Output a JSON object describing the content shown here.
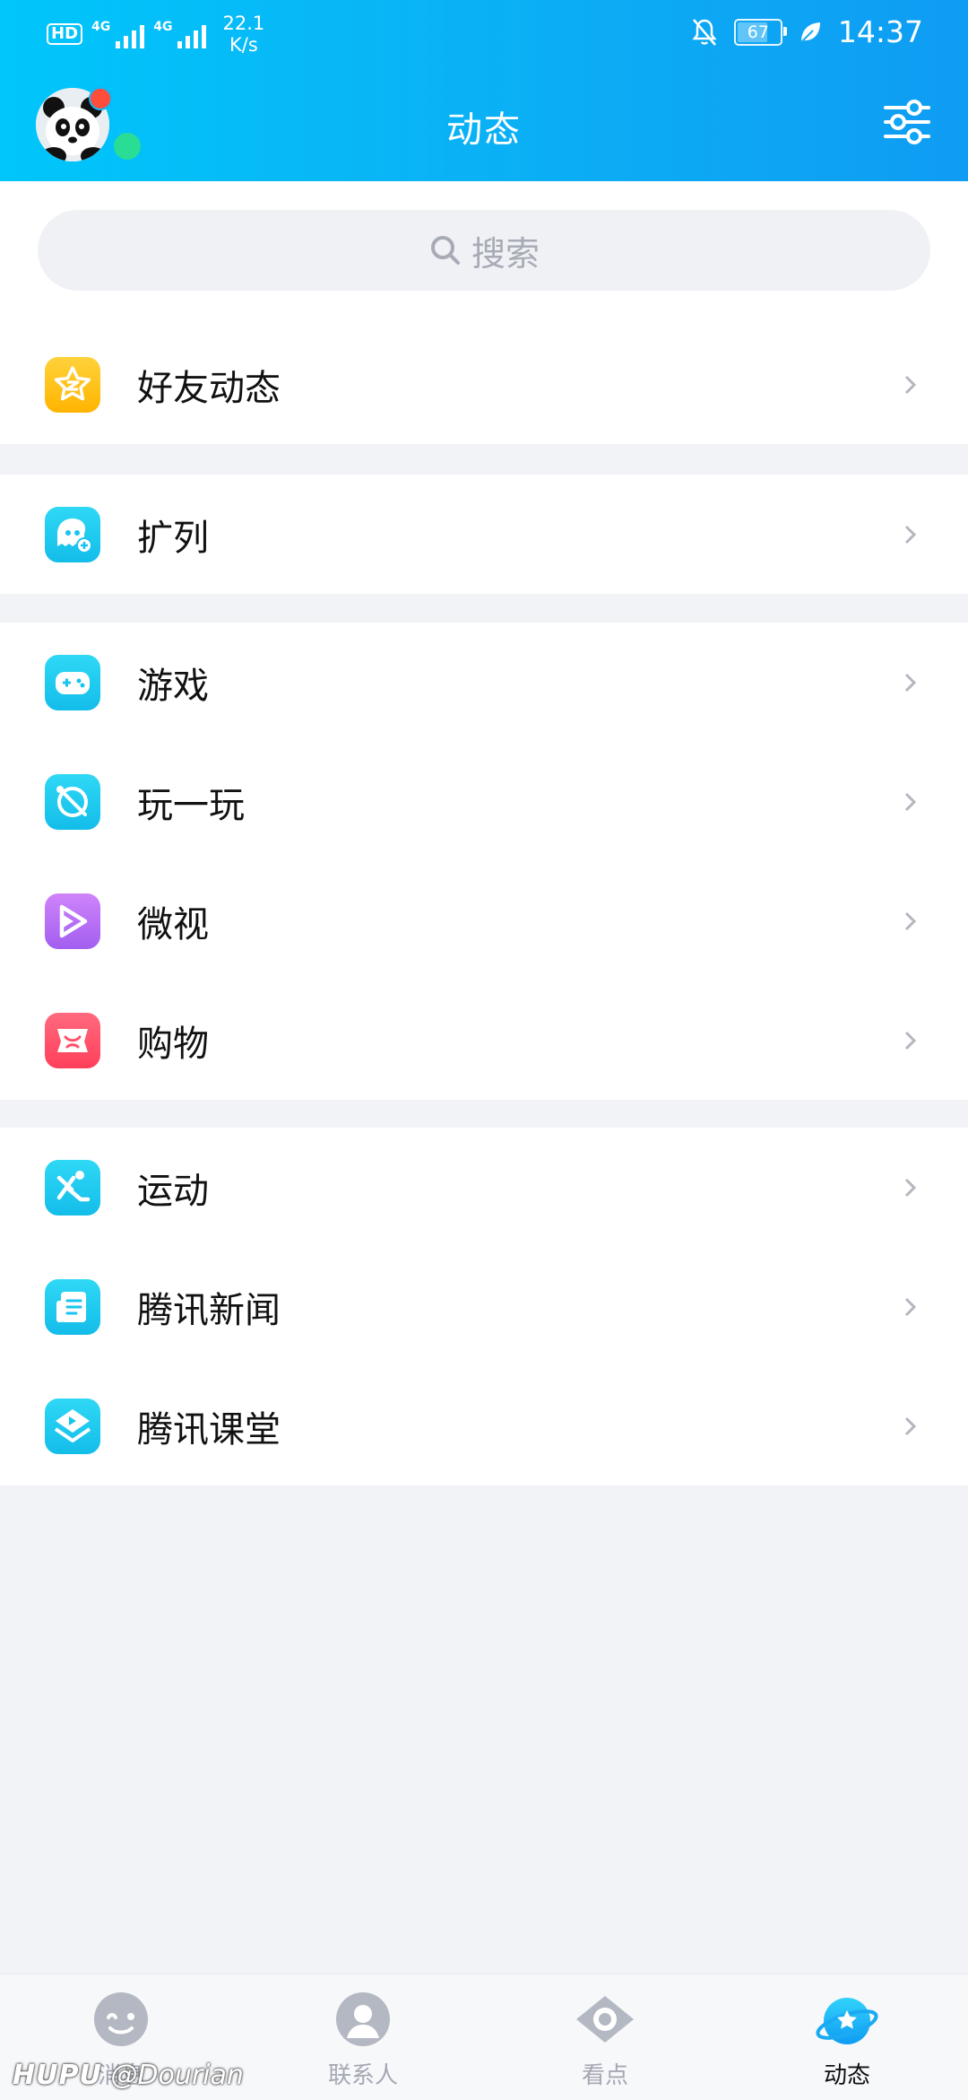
{
  "status_bar": {
    "hd": "HD",
    "network1": "4G",
    "network2": "4G",
    "speed_value": "22.1",
    "speed_unit": "K/s",
    "battery": "67",
    "time": "14:37"
  },
  "header": {
    "title": "动态"
  },
  "search": {
    "placeholder": "搜索"
  },
  "groups": [
    {
      "items": [
        {
          "label": "好友动态",
          "icon": "qzone-star-icon",
          "color": "#ffc21a"
        }
      ]
    },
    {
      "items": [
        {
          "label": "扩列",
          "icon": "add-friend-face-icon",
          "color": "#19cbf0"
        }
      ]
    },
    {
      "items": [
        {
          "label": "游戏",
          "icon": "gamepad-icon",
          "color": "#19cbf0"
        },
        {
          "label": "玩一玩",
          "icon": "planet-icon",
          "color": "#19cbf0"
        },
        {
          "label": "微视",
          "icon": "weishi-play-icon",
          "color": "#b56cf5"
        },
        {
          "label": "购物",
          "icon": "shopping-icon",
          "color": "#ff4f6a"
        }
      ]
    },
    {
      "items": [
        {
          "label": "运动",
          "icon": "running-icon",
          "color": "#19cbf0"
        },
        {
          "label": "腾讯新闻",
          "icon": "news-icon",
          "color": "#19cbf0"
        },
        {
          "label": "腾讯课堂",
          "icon": "classroom-icon",
          "color": "#19cbf0"
        }
      ]
    }
  ],
  "bottom_nav": [
    {
      "label": "消息",
      "icon": "message-icon",
      "active": false
    },
    {
      "label": "联系人",
      "icon": "contacts-icon",
      "active": false
    },
    {
      "label": "看点",
      "icon": "eye-icon",
      "active": false
    },
    {
      "label": "动态",
      "icon": "planet-star-icon",
      "active": true
    }
  ],
  "watermark": {
    "brand": "HUPU",
    "user": "@Dourian"
  },
  "colors": {
    "header_start": "#00c6fb",
    "header_end": "#0f9cf3",
    "accent": "#19cbf0"
  }
}
